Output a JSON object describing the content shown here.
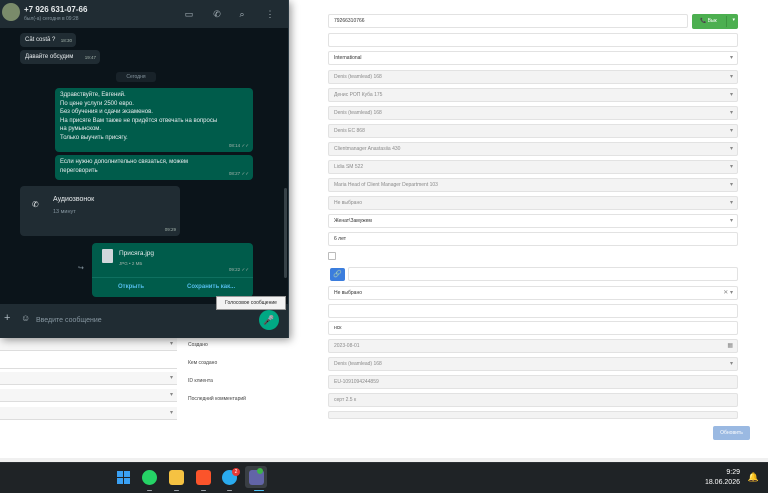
{
  "crm": {
    "phone": "79266310766",
    "call_button": "Вык",
    "empty_field": "",
    "language": "International",
    "fields": [
      "Denis (teamlead) 168",
      "Денис РОП Куба 175",
      "Denis (teamlead) 168",
      "Denis EC 868",
      "Clientmanager Anastasiia 430",
      "Lidia SM 522",
      "Maria Head of Client Manager Department 103",
      "Не выбрано"
    ],
    "marital_status": "Женат\\Замужем",
    "duration": "6 лет",
    "not_selected": "Не выбрано",
    "notes": "нск",
    "labels": {
      "created": "Создано",
      "created_by": "Кем создано",
      "client_id": "ID клиента",
      "last_comment": "Последний комментарий"
    },
    "created_date": "2023-08-01",
    "created_by": "Denis (teamlead) 168",
    "client_id": "EU-1091094244859",
    "last_comment": "серт 2.5 к",
    "save_button": "Обновить"
  },
  "whatsapp": {
    "contact_name": "+7 926 631-07-66",
    "contact_status": "был(-а) сегодня в 09:28",
    "messages": {
      "m1": {
        "text": "Căt costă ?",
        "time": "18:30"
      },
      "m2": {
        "text": "Давайте обсудим",
        "time": "19:47"
      },
      "date_divider": "Сегодня",
      "m3": {
        "lines": [
          "Здравствуйте, Евгений.",
          "По цене услуги 2500 евро.",
          "Без обучения и сдачи экзаменов.",
          "На присяге Вам также не придётся отвечать на вопросы",
          "на румынском.",
          "Только выучить присягу."
        ],
        "time": "08:14"
      },
      "m4": {
        "lines": [
          "Если нужно дополнительно связаться, можем",
          "переговорить"
        ],
        "time": "08:27"
      },
      "call": {
        "title": "Аудиозвонок",
        "duration": "13 минут",
        "time": "09:29"
      },
      "file": {
        "name": "Присяга.jpg",
        "meta": "JPG • 2 МБ",
        "time": "09:22",
        "open": "Открыть",
        "save": "Сохранить как..."
      }
    },
    "input_placeholder": "Введите сообщение",
    "voice_tooltip": "Голосовое сообщение"
  },
  "taskbar": {
    "time": "9:29",
    "date": "18.06.2026",
    "telegram_badge": "2"
  }
}
